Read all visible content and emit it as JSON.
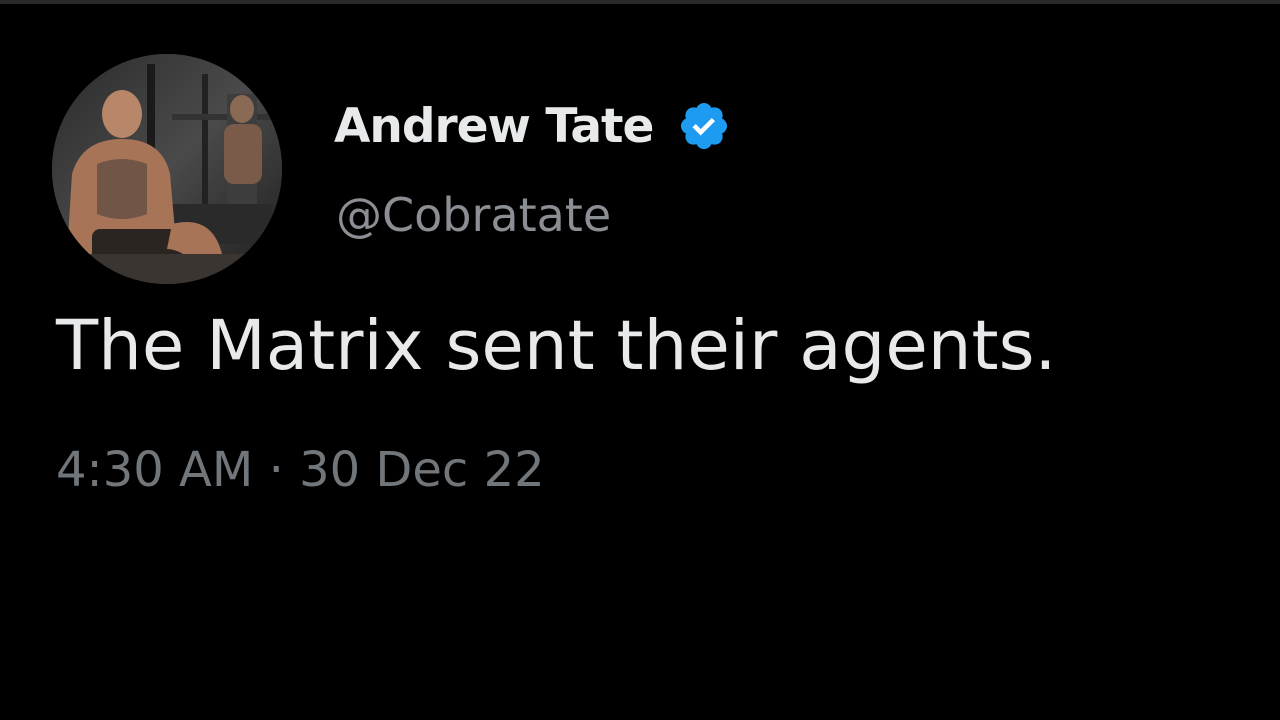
{
  "tweet": {
    "author": {
      "display_name": "Andrew Tate",
      "handle": "@Cobratate",
      "verified": true,
      "verified_icon": "verified-badge-icon",
      "verified_color": "#1d9bf0"
    },
    "text": "The Matrix sent their agents.",
    "time": "4:30 AM",
    "separator": "·",
    "date": "30 Dec 22"
  },
  "colors": {
    "background": "#000000",
    "primary_text": "#e7e9ea",
    "secondary_text": "#71767b"
  }
}
